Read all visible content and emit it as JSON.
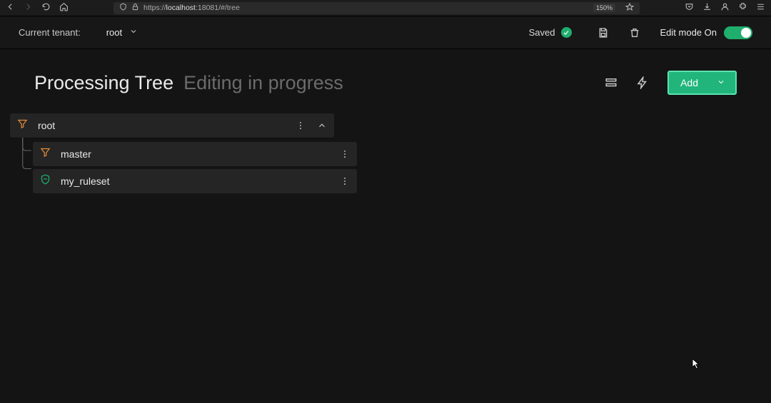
{
  "browser": {
    "url_prefix": "https://",
    "url_host": "localhost",
    "url_rest": ":18081/#/tree",
    "zoom": "150%"
  },
  "header": {
    "tenant_label": "Current tenant:",
    "tenant_value": "root",
    "saved_label": "Saved",
    "edit_mode_label": "Edit mode On",
    "edit_mode_on": true
  },
  "page": {
    "title": "Processing Tree",
    "subtitle": "Editing in progress",
    "add_button_label": "Add"
  },
  "tree": {
    "root": {
      "label": "root",
      "icon": "funnel"
    },
    "children": [
      {
        "label": "master",
        "icon": "funnel"
      },
      {
        "label": "my_ruleset",
        "icon": "shield"
      }
    ]
  }
}
